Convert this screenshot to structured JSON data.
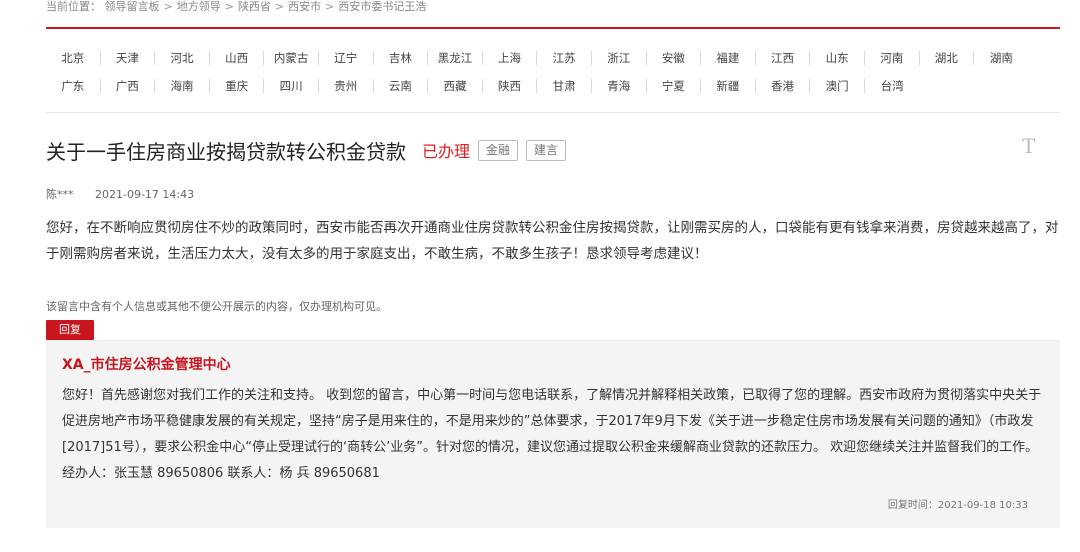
{
  "breadcrumb": {
    "prefix": "当前位置：",
    "items": [
      "领导留言板",
      "地方领导",
      "陕西省",
      "西安市",
      "西安市委书记王浩"
    ],
    "separator": ">"
  },
  "provinces": {
    "row1": [
      "北京",
      "天津",
      "河北",
      "山西",
      "内蒙古",
      "辽宁",
      "吉林",
      "黑龙江",
      "上海",
      "江苏",
      "浙江",
      "安徽",
      "福建",
      "江西",
      "山东",
      "河南",
      "湖北",
      "湖南"
    ],
    "row2": [
      "广东",
      "广西",
      "海南",
      "重庆",
      "四川",
      "贵州",
      "云南",
      "西藏",
      "陕西",
      "甘肃",
      "青海",
      "宁夏",
      "新疆",
      "香港",
      "澳门",
      "台湾"
    ]
  },
  "post": {
    "title": "关于一手住房商业按揭贷款转公积金贷款",
    "status": "已办理",
    "tags": [
      "金融",
      "建言"
    ],
    "corner_mark": "T",
    "author": "陈***",
    "date": "2021-09-17 14:43",
    "body": "您好，在不断响应贯彻房住不炒的政策同时，西安市能否再次开通商业住房贷款转公积金住房按揭贷款，让刚需买房的人，口袋能有更有钱拿来消费，房贷越来越高了，对于刚需购房者来说，生活压力太大，没有太多的用于家庭支出，不敢生病，不敢多生孩子！恳求领导考虑建议！",
    "privacy_notice": "该留言中含有个人信息或其他不便公开展示的内容，仅办理机构可见。"
  },
  "reply": {
    "button_label": "回复",
    "org": "XA_市住房公积金管理中心",
    "text": "您好！首先感谢您对我们工作的关注和支持。 收到您的留言，中心第一时间与您电话联系，了解情况并解释相关政策，已取得了您的理解。西安市政府为贯彻落实中央关于促进房地产市场平稳健康发展的有关规定，坚持“房子是用来住的，不是用来炒的”总体要求，于2017年9月下发《关于进一步稳定住房市场发展有关问题的通知》（市政发[2017]51号），要求公积金中心“停止受理试行的‘商转公’业务”。针对您的情况，建议您通过提取公积金来缓解商业贷款的还款压力。 欢迎您继续关注并监督我们的工作。经办人：张玉慧 89650806 联系人：杨 兵 89650681",
    "time_label": "回复时间：",
    "time": "2021-09-18 10:33"
  },
  "colors": {
    "accent": "#c9151e",
    "status": "#dd2222"
  }
}
